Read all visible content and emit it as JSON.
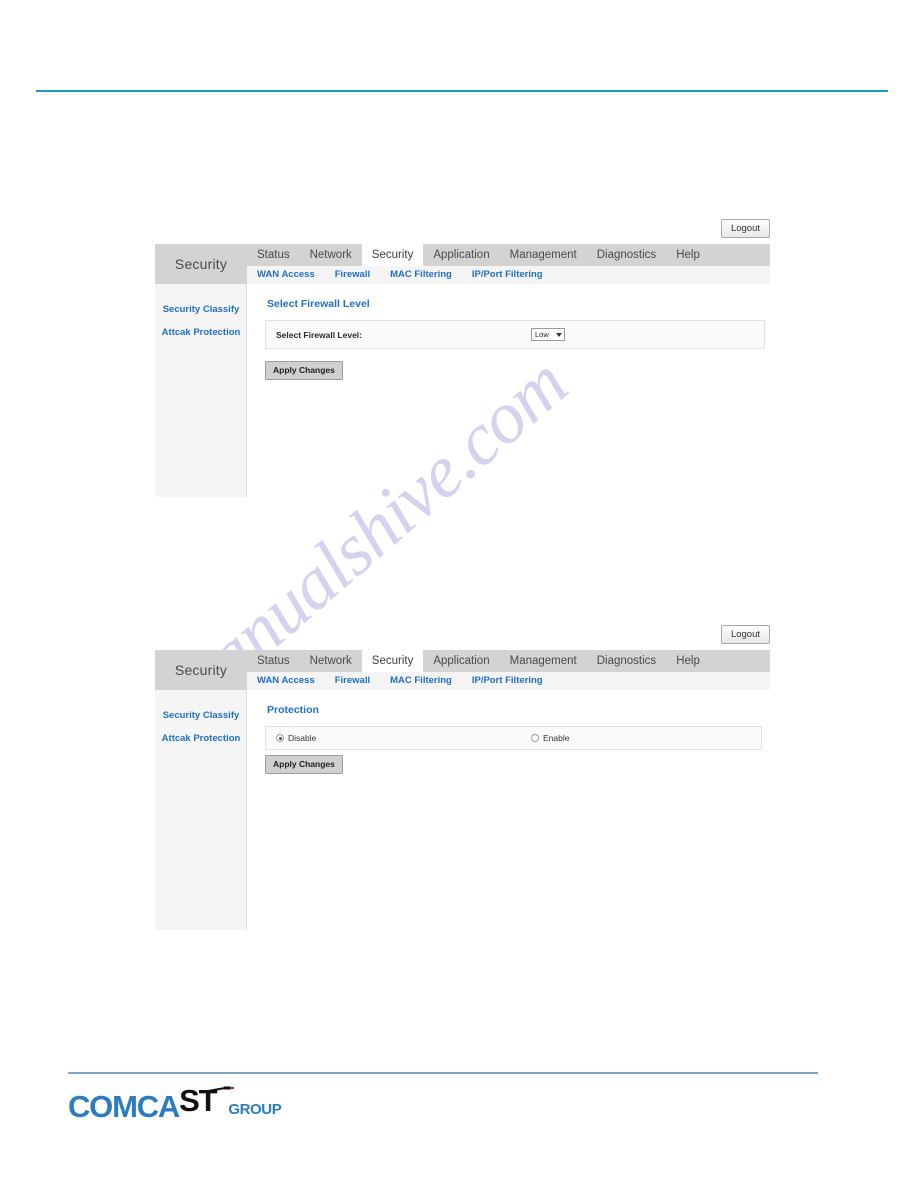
{
  "page": {
    "watermark": "manualshive.com"
  },
  "panels": [
    {
      "logout_label": "Logout",
      "brand": "Security",
      "tabs": [
        {
          "label": "Status",
          "active": false
        },
        {
          "label": "Network",
          "active": false
        },
        {
          "label": "Security",
          "active": true
        },
        {
          "label": "Application",
          "active": false
        },
        {
          "label": "Management",
          "active": false
        },
        {
          "label": "Diagnostics",
          "active": false
        },
        {
          "label": "Help",
          "active": false
        }
      ],
      "subtabs": [
        {
          "label": "WAN Access"
        },
        {
          "label": "Firewall"
        },
        {
          "label": "MAC Filtering"
        },
        {
          "label": "IP/Port Filtering"
        }
      ],
      "sidebar": [
        {
          "label": "Security Classify"
        },
        {
          "label": "Attcak Protection"
        }
      ],
      "section_title": "Select Firewall Level",
      "field_label": "Select Firewall Level:",
      "select_value": "Low",
      "select_options": [
        "Low"
      ],
      "apply_label": "Apply Changes"
    },
    {
      "logout_label": "Logout",
      "brand": "Security",
      "tabs": [
        {
          "label": "Status",
          "active": false
        },
        {
          "label": "Network",
          "active": false
        },
        {
          "label": "Security",
          "active": true
        },
        {
          "label": "Application",
          "active": false
        },
        {
          "label": "Management",
          "active": false
        },
        {
          "label": "Diagnostics",
          "active": false
        },
        {
          "label": "Help",
          "active": false
        }
      ],
      "subtabs": [
        {
          "label": "WAN Access"
        },
        {
          "label": "Firewall"
        },
        {
          "label": "MAC Filtering"
        },
        {
          "label": "IP/Port Filtering"
        }
      ],
      "sidebar": [
        {
          "label": "Security Classify"
        },
        {
          "label": "Attcak Protection"
        }
      ],
      "section_title": "Protection",
      "radios": [
        {
          "label": "Disable",
          "checked": true
        },
        {
          "label": "Enable",
          "checked": false
        }
      ],
      "apply_label": "Apply Changes"
    }
  ],
  "footer": {
    "logo_part1": "COMCA",
    "logo_part2": "ST",
    "logo_part3": "GROUP"
  },
  "colors": {
    "top_rule": "#1a9cc4",
    "footer_rule": "#7aa7c7",
    "link_blue": "#1f6fc4",
    "logo_blue": "#2b7cc0",
    "nav_grey": "#d3d3d3",
    "watermark": "#b9b7e6"
  }
}
